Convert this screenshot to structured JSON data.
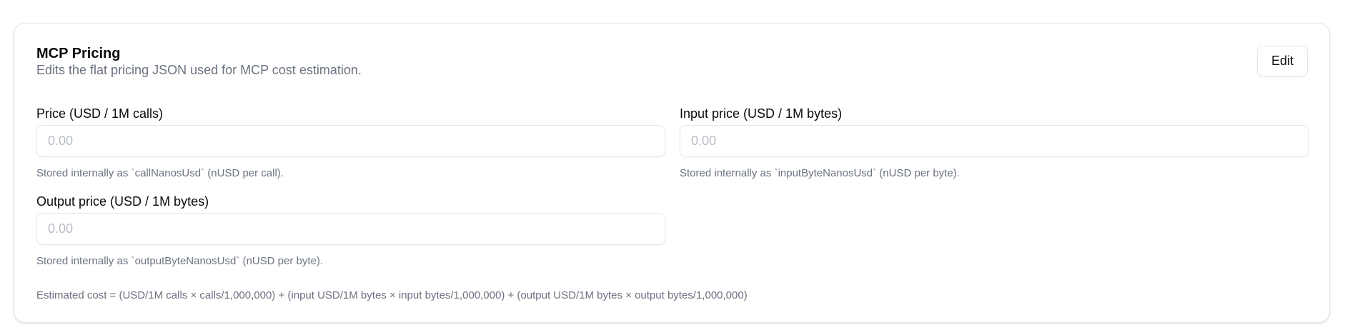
{
  "card": {
    "title": "MCP Pricing",
    "description": "Edits the flat pricing JSON used for MCP cost estimation.",
    "edit_label": "Edit"
  },
  "fields": [
    {
      "label": "Price (USD / 1M calls)",
      "value": "",
      "placeholder": "0.00",
      "help": "Stored internally as `callNanosUsd` (nUSD per call)."
    },
    {
      "label": "Input price (USD / 1M bytes)",
      "value": "",
      "placeholder": "0.00",
      "help": "Stored internally as `inputByteNanosUsd` (nUSD per byte)."
    },
    {
      "label": "Output price (USD / 1M bytes)",
      "value": "",
      "placeholder": "0.00",
      "help": "Stored internally as `outputByteNanosUsd` (nUSD per byte)."
    }
  ],
  "formula": "Estimated cost = (USD/1M calls × calls/1,000,000) + (input USD/1M bytes × input bytes/1,000,000) + (output USD/1M bytes × output bytes/1,000,000)"
}
